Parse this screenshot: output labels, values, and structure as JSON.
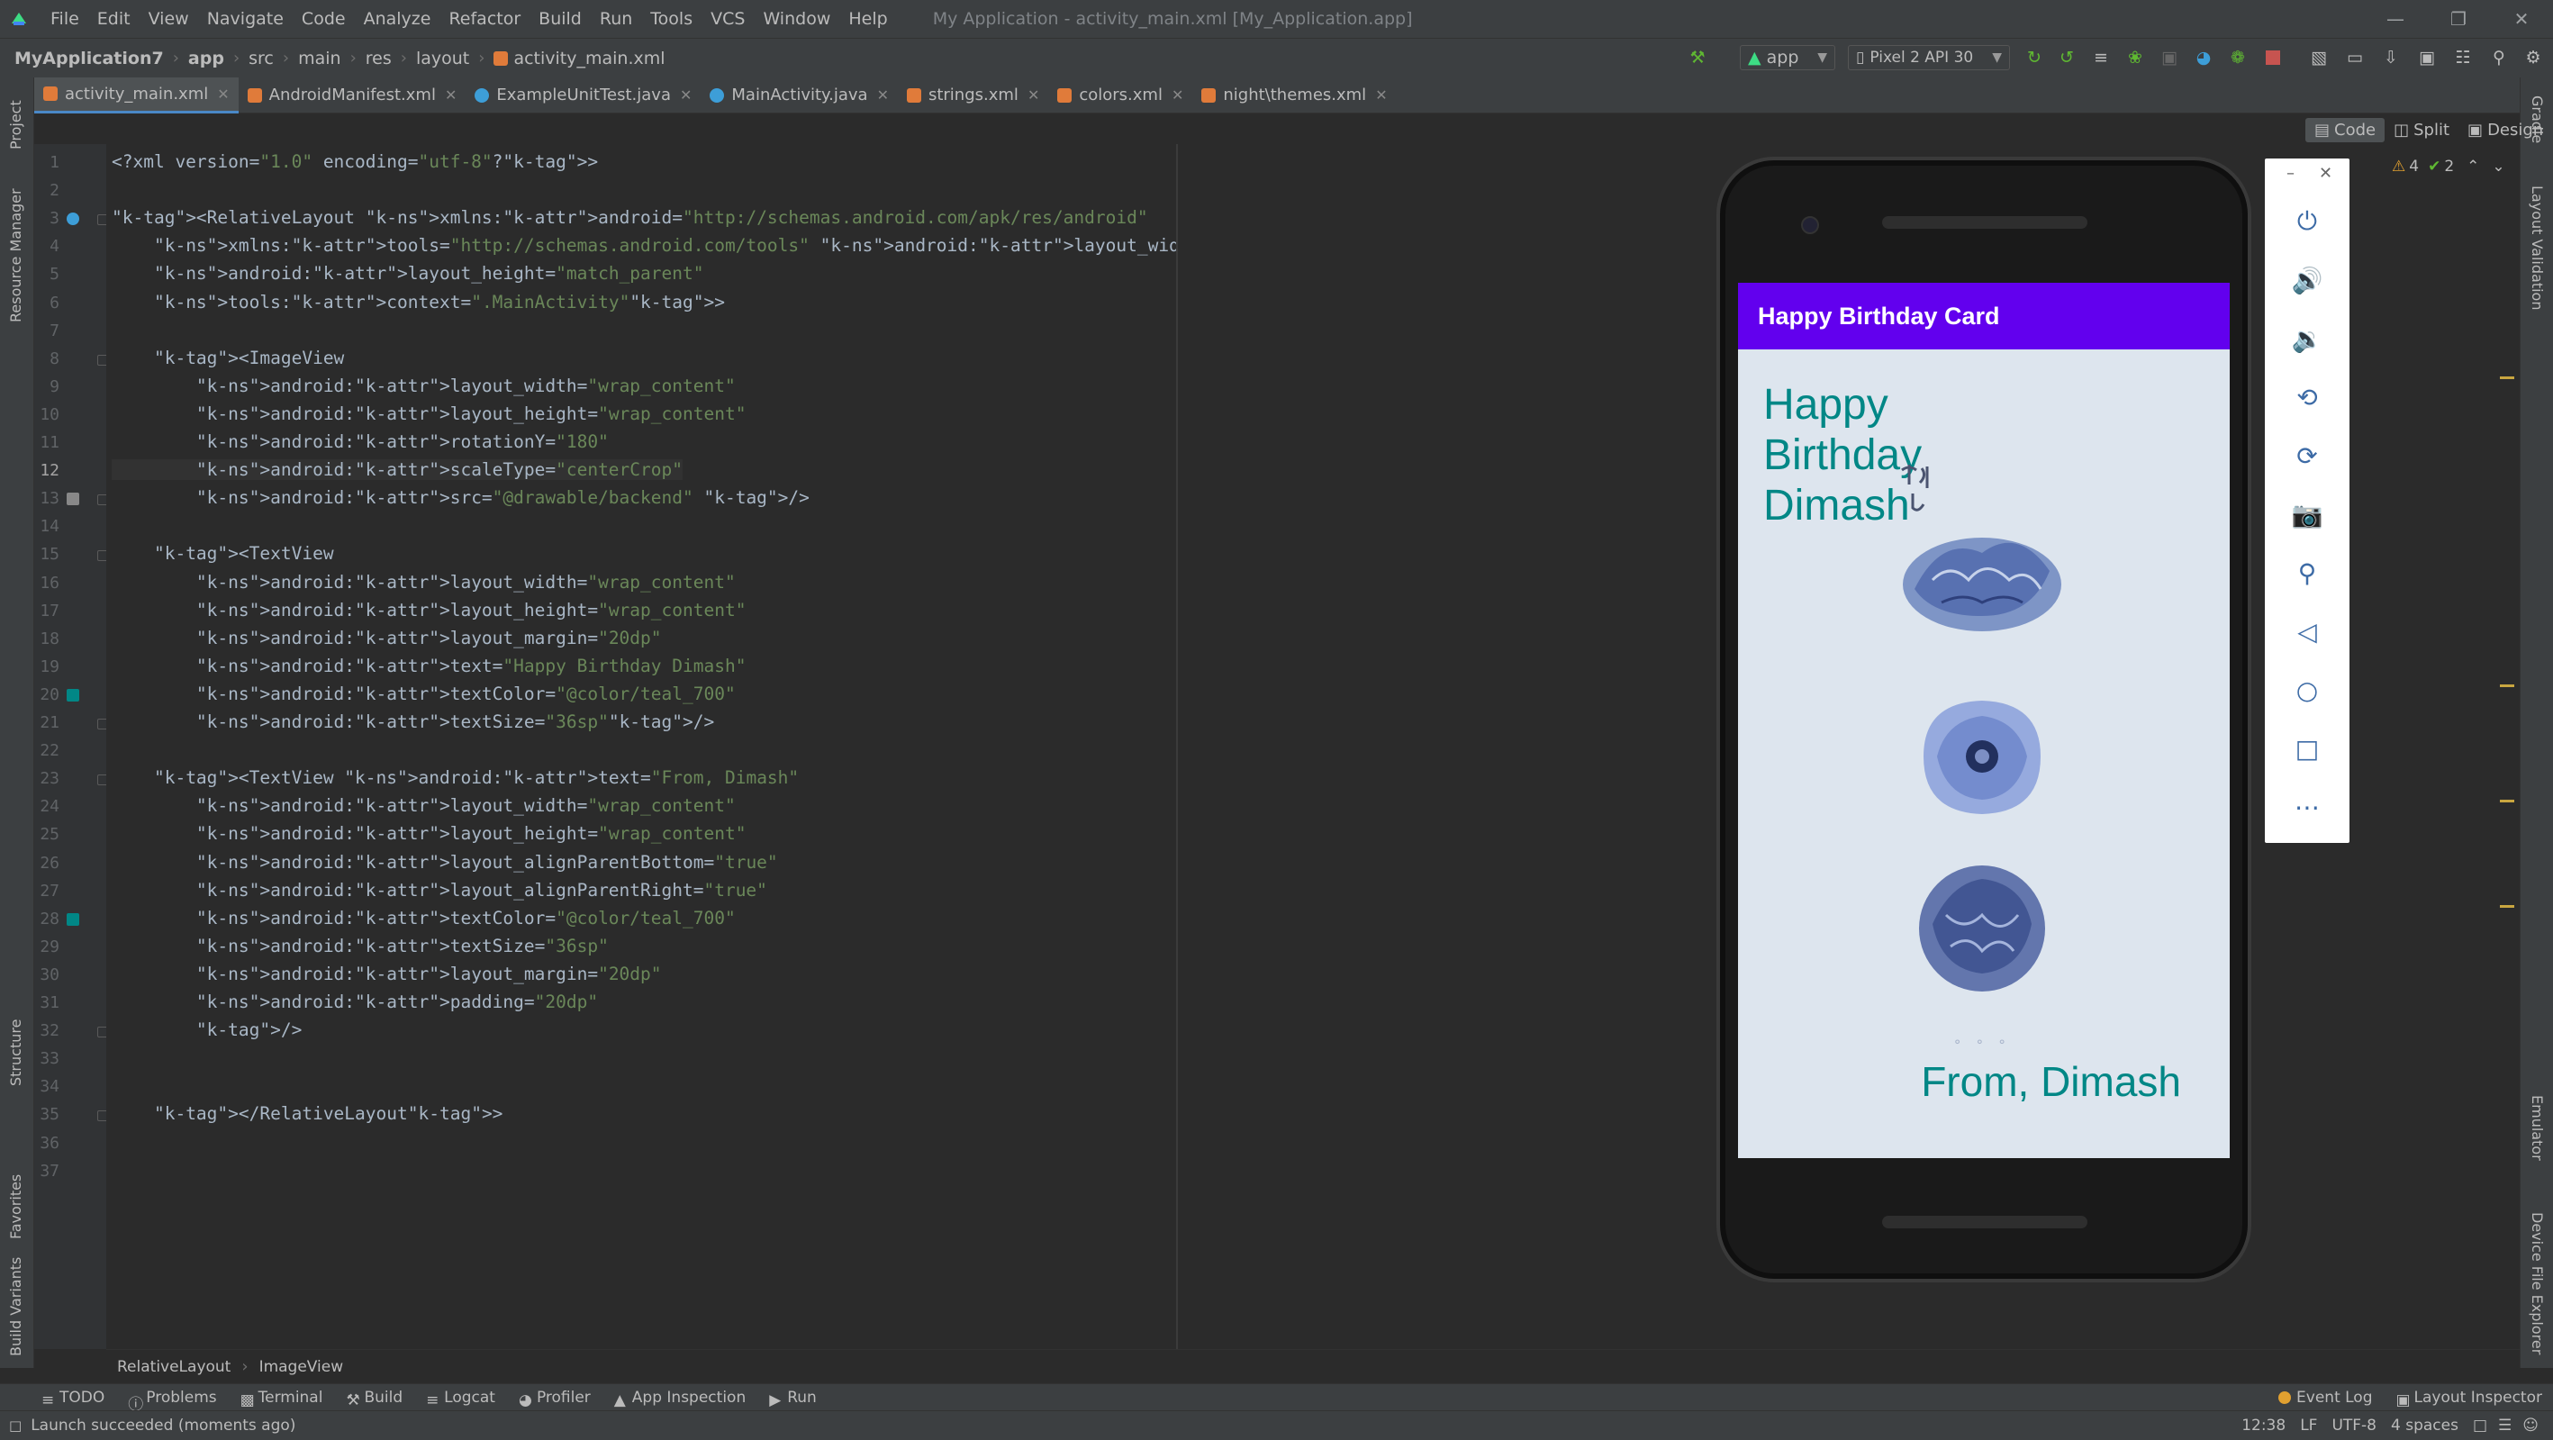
{
  "menubar": {
    "items": [
      "File",
      "Edit",
      "View",
      "Navigate",
      "Code",
      "Analyze",
      "Refactor",
      "Build",
      "Run",
      "Tools",
      "VCS",
      "Window",
      "Help"
    ],
    "window_title": "My Application - activity_main.xml [My_Application.app]"
  },
  "navbar": {
    "breadcrumb": [
      "MyApplication7",
      "app",
      "src",
      "main",
      "res",
      "layout",
      "activity_main.xml"
    ],
    "run_config": "app",
    "device": "Pixel 2 API 30"
  },
  "tabs": [
    {
      "label": "activity_main.xml",
      "color": "#e07b3a",
      "active": true
    },
    {
      "label": "AndroidManifest.xml",
      "color": "#e07b3a",
      "active": false
    },
    {
      "label": "ExampleUnitTest.java",
      "color": "#3d9ed8",
      "active": false
    },
    {
      "label": "MainActivity.java",
      "color": "#3d9ed8",
      "active": false
    },
    {
      "label": "strings.xml",
      "color": "#e07b3a",
      "active": false
    },
    {
      "label": "colors.xml",
      "color": "#e07b3a",
      "active": false
    },
    {
      "label": "night\\themes.xml",
      "color": "#e07b3a",
      "active": false
    }
  ],
  "view_modes": {
    "code": "Code",
    "split": "Split",
    "design": "Design"
  },
  "inspections": {
    "warnings": "4",
    "ok": "2"
  },
  "left_tools": [
    "Project",
    "Resource Manager",
    "Structure",
    "Favorites",
    "Build Variants"
  ],
  "right_tools": [
    "Gradle",
    "Layout Validation",
    "Emulator",
    "Device File Explorer"
  ],
  "code_lines": [
    "<?xml version=\"1.0\" encoding=\"utf-8\"?>",
    "",
    "<RelativeLayout xmlns:android=\"http://schemas.android.com/apk/res/android\"",
    "    xmlns:tools=\"http://schemas.android.com/tools\" android:layout_width=\"match_parent\"",
    "    android:layout_height=\"match_parent\"",
    "    tools:context=\".MainActivity\">",
    "",
    "    <ImageView",
    "        android:layout_width=\"wrap_content\"",
    "        android:layout_height=\"wrap_content\"",
    "        android:rotationY=\"180\"",
    "        android:scaleType=\"centerCrop\"",
    "        android:src=\"@drawable/backend\" />",
    "",
    "    <TextView",
    "        android:layout_width=\"wrap_content\"",
    "        android:layout_height=\"wrap_content\"",
    "        android:layout_margin=\"20dp\"",
    "        android:text=\"Happy Birthday Dimash\"",
    "        android:textColor=\"@color/teal_700\"",
    "        android:textSize=\"36sp\"/>",
    "",
    "    <TextView android:text=\"From, Dimash\"",
    "        android:layout_width=\"wrap_content\"",
    "        android:layout_height=\"wrap_content\"",
    "        android:layout_alignParentBottom=\"true\"",
    "        android:layout_alignParentRight=\"true\"",
    "        android:textColor=\"@color/teal_700\"",
    "        android:textSize=\"36sp\"",
    "        android:layout_margin=\"20dp\"",
    "        android:padding=\"20dp\"",
    "        />",
    "",
    "",
    "    </RelativeLayout>",
    "",
    ""
  ],
  "current_line": 12,
  "phone": {
    "app_title": "Happy Birthday Card",
    "greeting": "Happy Birthday Dimash",
    "signature": "From, Dimash",
    "appbar_color": "#6200ee",
    "text_color": "#018786"
  },
  "emulator_controls": [
    "power-icon",
    "volume-up-icon",
    "volume-down-icon",
    "rotate-left-icon",
    "rotate-right-icon",
    "camera-icon",
    "zoom-icon",
    "back-icon",
    "home-icon",
    "overview-icon",
    "more-icon"
  ],
  "xml_breadcrumb": [
    "RelativeLayout",
    "ImageView"
  ],
  "bottom_tools": [
    "TODO",
    "Problems",
    "Terminal",
    "Build",
    "Logcat",
    "Profiler",
    "App Inspection",
    "Run"
  ],
  "bottom_right_tools": [
    "Event Log",
    "Layout Inspector"
  ],
  "status": {
    "message": "Launch succeeded (moments ago)",
    "position": "12:38",
    "line_sep": "LF",
    "encoding": "UTF-8",
    "indent": "4 spaces"
  }
}
